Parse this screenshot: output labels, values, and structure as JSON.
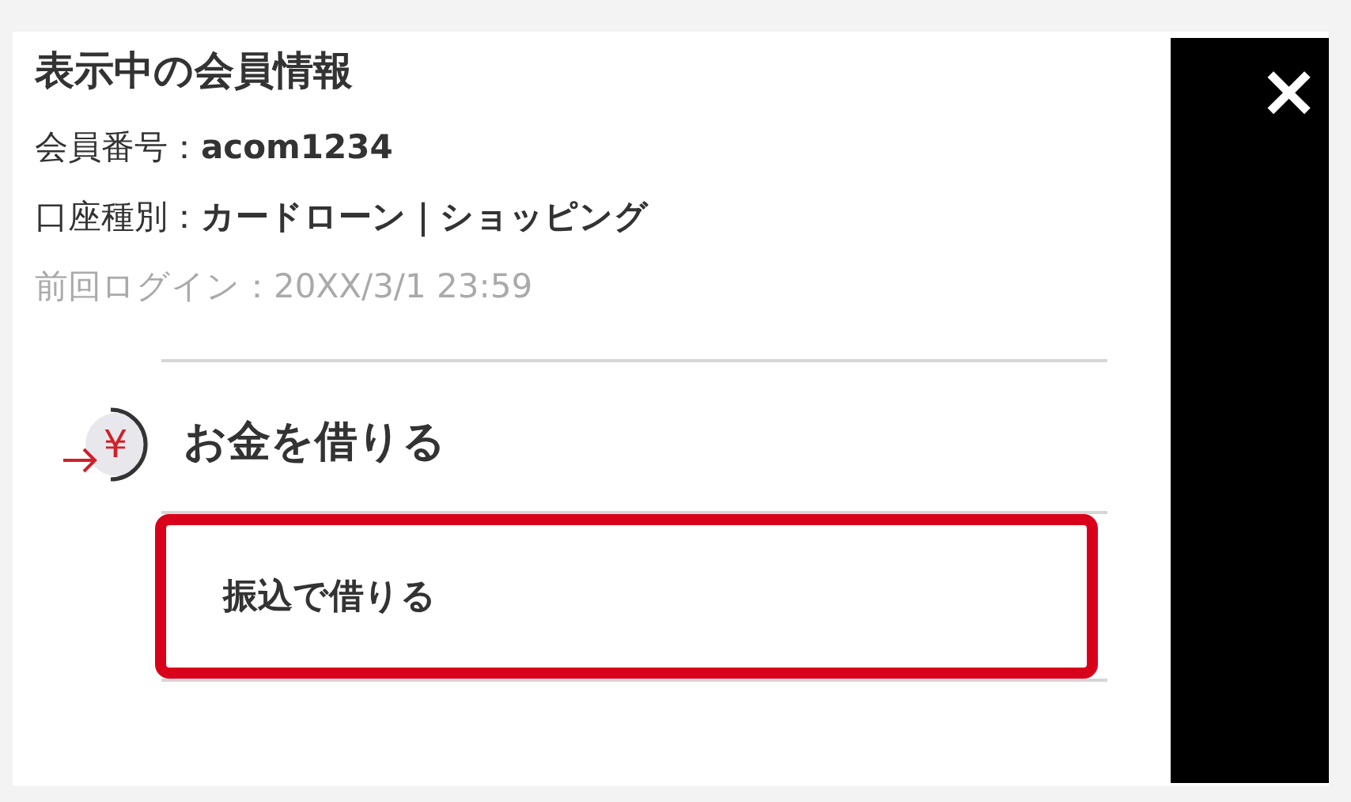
{
  "close_button": {
    "label": "×"
  },
  "member_info": {
    "title": "表示中の会員情報",
    "rows": [
      {
        "label": "会員番号：",
        "value": "acom1234",
        "kind": "strong"
      },
      {
        "label": "口座種別：",
        "value": "カードローン｜ショッピング",
        "kind": "strong"
      },
      {
        "label": "前回ログイン：",
        "value": "20XX/3/1 23:59",
        "kind": "muted"
      }
    ]
  },
  "section": {
    "icon_glyph": "¥",
    "title": "お金を借りる",
    "items": [
      {
        "label": "振込で借りる",
        "highlighted": true
      }
    ]
  }
}
